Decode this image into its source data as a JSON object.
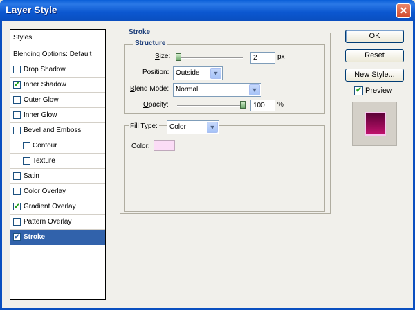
{
  "window": {
    "title": "Layer Style",
    "close_glyph": "✕"
  },
  "styles_list": {
    "header": "Styles",
    "blending": "Blending Options: Default",
    "items": [
      {
        "label": "Drop Shadow",
        "checked": false,
        "indent": false
      },
      {
        "label": "Inner Shadow",
        "checked": true,
        "indent": false
      },
      {
        "label": "Outer Glow",
        "checked": false,
        "indent": false
      },
      {
        "label": "Inner Glow",
        "checked": false,
        "indent": false
      },
      {
        "label": "Bevel and Emboss",
        "checked": false,
        "indent": false
      },
      {
        "label": "Contour",
        "checked": false,
        "indent": true
      },
      {
        "label": "Texture",
        "checked": false,
        "indent": true
      },
      {
        "label": "Satin",
        "checked": false,
        "indent": false
      },
      {
        "label": "Color Overlay",
        "checked": false,
        "indent": false
      },
      {
        "label": "Gradient Overlay",
        "checked": true,
        "indent": false
      },
      {
        "label": "Pattern Overlay",
        "checked": false,
        "indent": false
      },
      {
        "label": "Stroke",
        "checked": true,
        "indent": false,
        "selected": true
      }
    ]
  },
  "stroke": {
    "section_title": "Stroke",
    "structure_title": "Structure",
    "size_label": "Size:",
    "size_value": "2",
    "size_unit": "px",
    "size_level": 0.02,
    "position_label": "Position:",
    "position_value": "Outside",
    "blend_label": "Blend Mode:",
    "blend_value": "Normal",
    "opacity_label": "Opacity:",
    "opacity_value": "100",
    "opacity_unit": "%",
    "opacity_level": 1.0,
    "fill_type_label": "Fill Type:",
    "fill_type_value": "Color",
    "color_label": "Color:",
    "color_hex": "#fbdcf6"
  },
  "buttons": {
    "ok": "OK",
    "reset": "Reset",
    "new_style": "New Style...",
    "preview_label": "Preview",
    "preview_checked": true
  },
  "colors": {
    "title_bar": "#0b57d0",
    "selection": "#3162ab",
    "check": "#21a121"
  }
}
